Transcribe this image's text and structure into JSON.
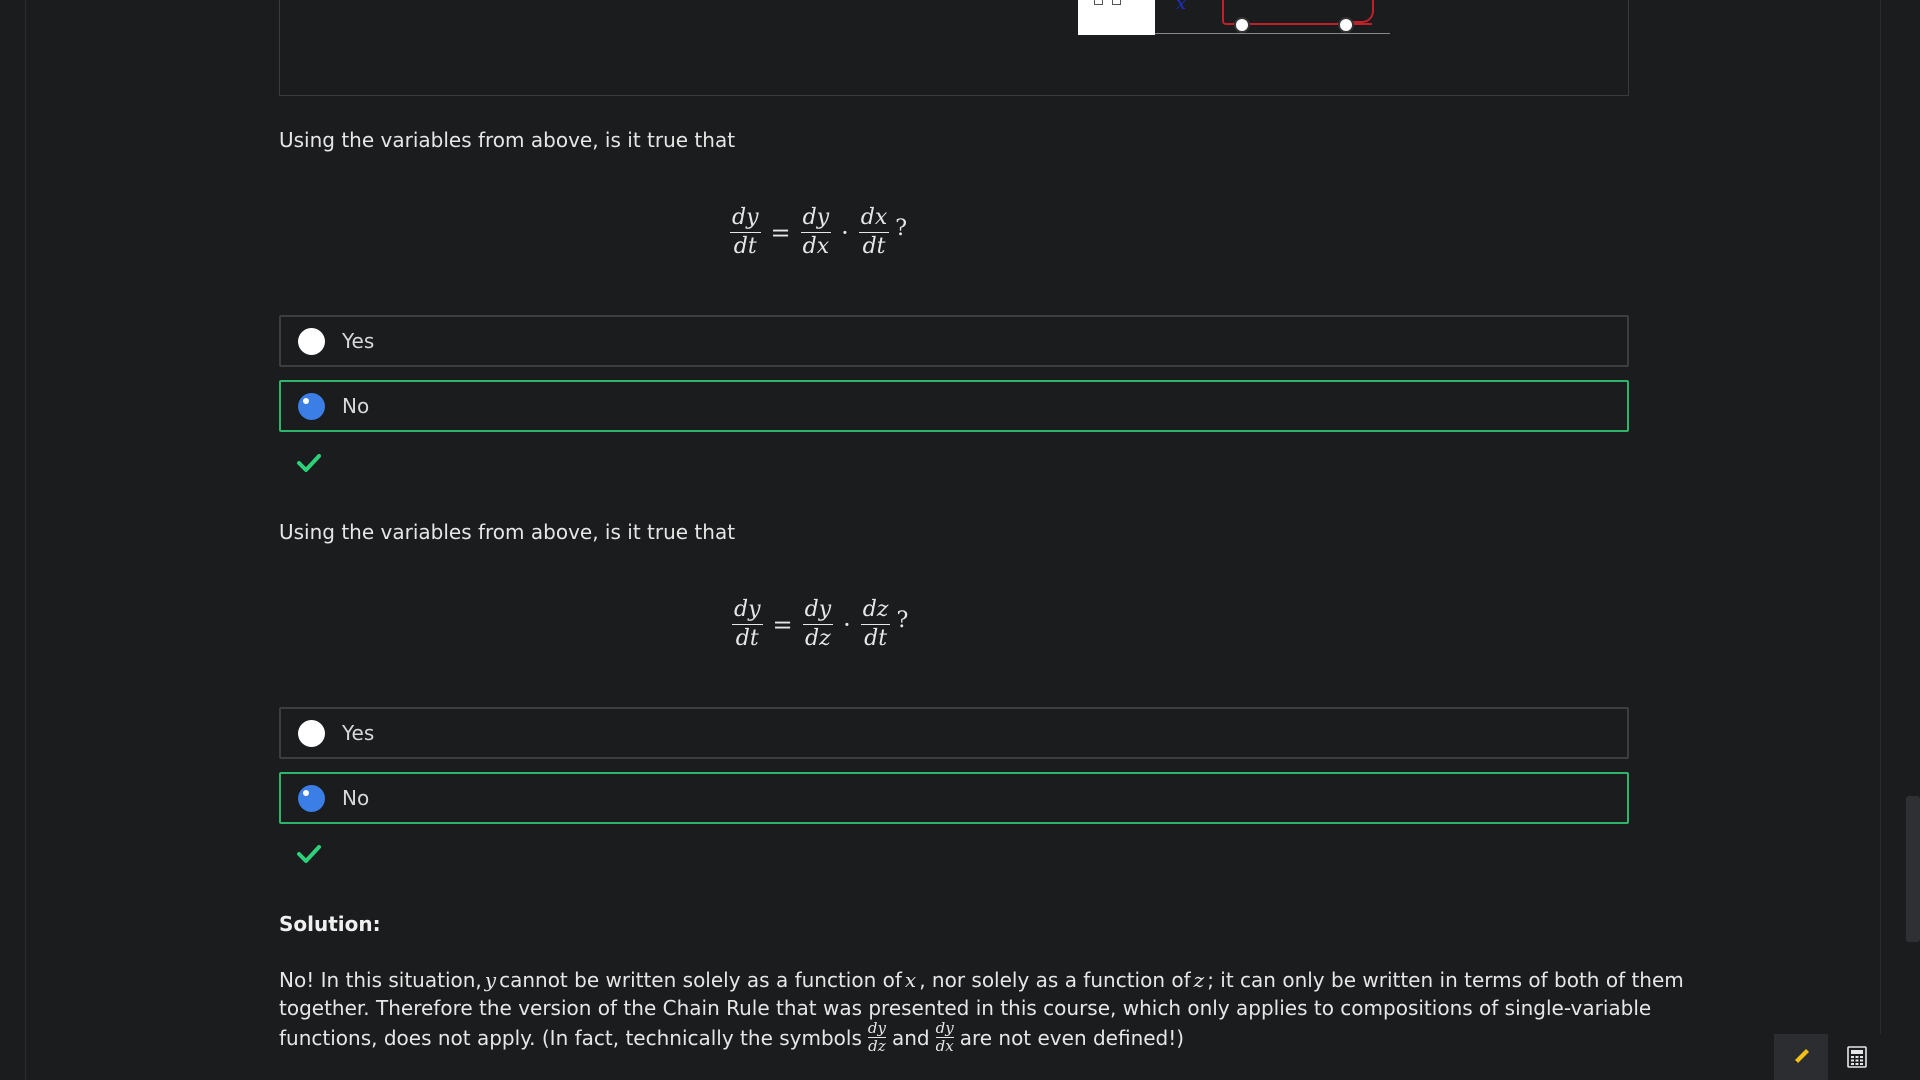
{
  "question1": {
    "prompt": "Using the variables from above, is it true that",
    "equation": {
      "lhs": {
        "num": "dy",
        "den": "dt"
      },
      "equals": "=",
      "f1": {
        "num": "dy",
        "den": "dx"
      },
      "dot": "·",
      "f2": {
        "num": "dx",
        "den": "dt"
      },
      "end": "?"
    },
    "options": [
      {
        "label": "Yes",
        "selected": false
      },
      {
        "label": "No",
        "selected": true
      }
    ]
  },
  "question2": {
    "prompt": "Using the variables from above, is it true that",
    "equation": {
      "lhs": {
        "num": "dy",
        "den": "dt"
      },
      "equals": "=",
      "f1": {
        "num": "dy",
        "den": "dz"
      },
      "dot": "·",
      "f2": {
        "num": "dz",
        "den": "dt"
      },
      "end": "?"
    },
    "options": [
      {
        "label": "Yes",
        "selected": false
      },
      {
        "label": "No",
        "selected": true
      }
    ]
  },
  "solution": {
    "title": "Solution:",
    "line1": {
      "a": "No! In this situation,",
      "v1": "y",
      "b": "cannot be written solely as a function of",
      "v2": "x",
      "c": ", nor solely as a function of",
      "v3": "z",
      "d": "; it can only be written in terms of both of them"
    },
    "line2": "together. Therefore the version of the Chain Rule that was presented in this course, which only applies to compositions of single-variable",
    "line3": {
      "a": "functions, does not apply. (In fact, technically the symbols",
      "f1": {
        "num": "dy",
        "den": "dz"
      },
      "and": "and",
      "f2": {
        "num": "dy",
        "den": "dx"
      },
      "b": "are not even defined!)"
    }
  },
  "figure": {
    "axis_label": "x"
  },
  "colors": {
    "correct_border": "#2fb46b",
    "radio_selected": "#3a7ee6",
    "check": "#2fd07a"
  },
  "icons": {
    "correct": "checkmark-icon",
    "pencil": "pencil-icon",
    "calculator": "calculator-icon"
  }
}
